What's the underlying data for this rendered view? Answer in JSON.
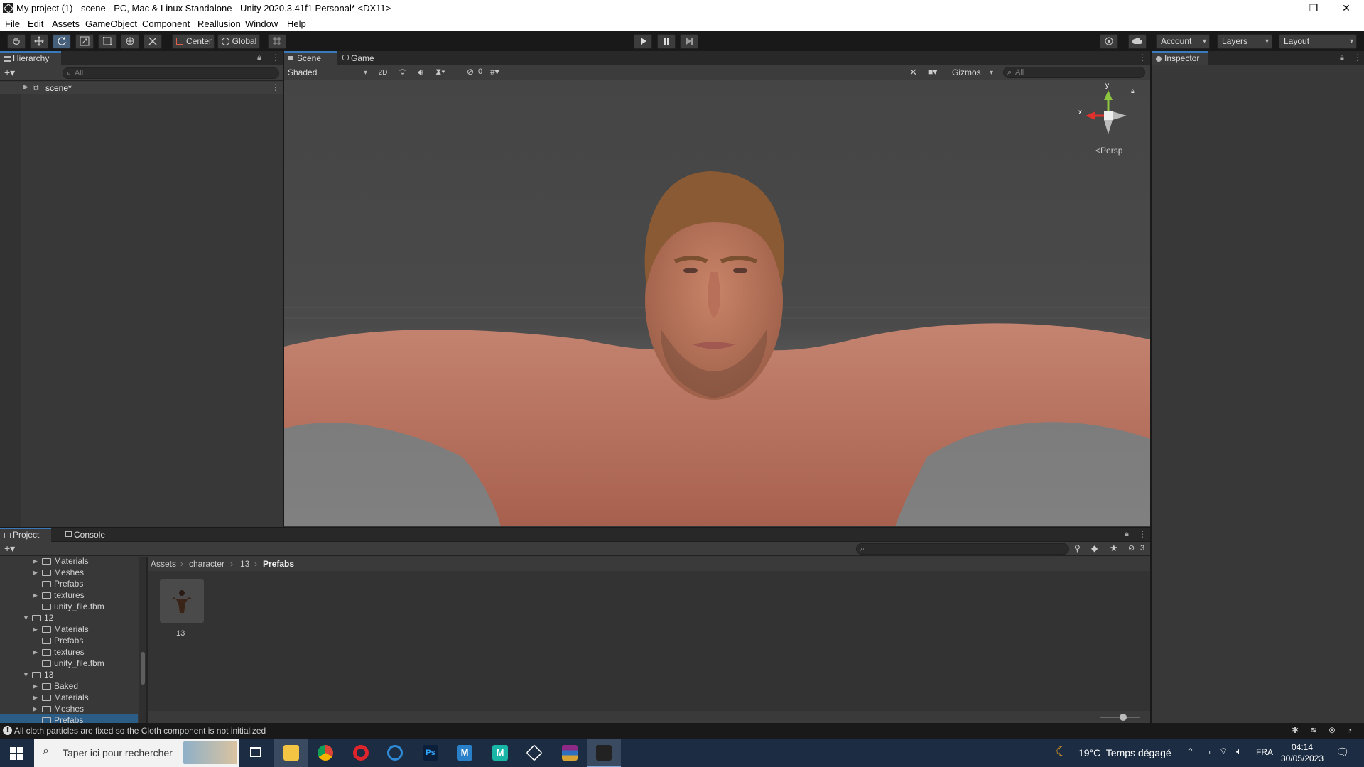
{
  "window": {
    "title": "My project (1) - scene - PC, Mac & Linux Standalone - Unity 2020.3.41f1 Personal* <DX11>",
    "minimize": "—",
    "restore": "❐",
    "close": "✕"
  },
  "menu": [
    "File",
    "Edit",
    "Assets",
    "GameObject",
    "Component",
    "Reallusion",
    "Window",
    "Help"
  ],
  "toolbar": {
    "pivot_label": "Center",
    "space_label": "Global",
    "account_label": "Account",
    "layers_label": "Layers",
    "layout_label": "Layout"
  },
  "hierarchy": {
    "tab_label": "Hierarchy",
    "search_placeholder": "All",
    "scene_item": "scene*"
  },
  "scene_panel": {
    "tabs": [
      "Scene",
      "Game"
    ],
    "draw_mode": "Shaded",
    "mode_2d": "2D",
    "hidden_count": "0",
    "gizmos_label": "Gizmos",
    "search_placeholder": "All",
    "gizmo_axis_x": "x",
    "gizmo_axis_y": "y",
    "persp_label": "Persp"
  },
  "inspector": {
    "tab_label": "Inspector"
  },
  "project": {
    "tabs": [
      "Project",
      "Console"
    ],
    "hidden_count": "3",
    "breadcrumb": [
      "Assets",
      "character",
      "13",
      "Prefabs"
    ],
    "tree": [
      {
        "label": "Materials",
        "depth": 1,
        "arrow": true
      },
      {
        "label": "Meshes",
        "depth": 1,
        "arrow": true
      },
      {
        "label": "Prefabs",
        "depth": 1,
        "arrow": false
      },
      {
        "label": "textures",
        "depth": 1,
        "arrow": true
      },
      {
        "label": "unity_file.fbm",
        "depth": 1,
        "arrow": false
      },
      {
        "label": "12",
        "depth": 0,
        "arrow": true,
        "open": true
      },
      {
        "label": "Materials",
        "depth": 1,
        "arrow": true
      },
      {
        "label": "Prefabs",
        "depth": 1,
        "arrow": false
      },
      {
        "label": "textures",
        "depth": 1,
        "arrow": true
      },
      {
        "label": "unity_file.fbm",
        "depth": 1,
        "arrow": false
      },
      {
        "label": "13",
        "depth": 0,
        "arrow": true,
        "open": true
      },
      {
        "label": "Baked",
        "depth": 1,
        "arrow": true
      },
      {
        "label": "Materials",
        "depth": 1,
        "arrow": true
      },
      {
        "label": "Meshes",
        "depth": 1,
        "arrow": true
      },
      {
        "label": "Prefabs",
        "depth": 1,
        "arrow": false,
        "selected": true
      }
    ],
    "asset_name": "13"
  },
  "status": {
    "message": "All cloth particles are fixed so the Cloth component is not initialized"
  },
  "taskbar": {
    "search_placeholder": "Taper ici pour rechercher",
    "weather": "19°C  Temps dégagé",
    "language": "FRA",
    "time": "04:14",
    "date": "30/05/2023"
  },
  "colors": {
    "accent_blue": "#3a79bb",
    "panel_bg": "#383838",
    "taskbar_bg": "#1c2d43"
  }
}
